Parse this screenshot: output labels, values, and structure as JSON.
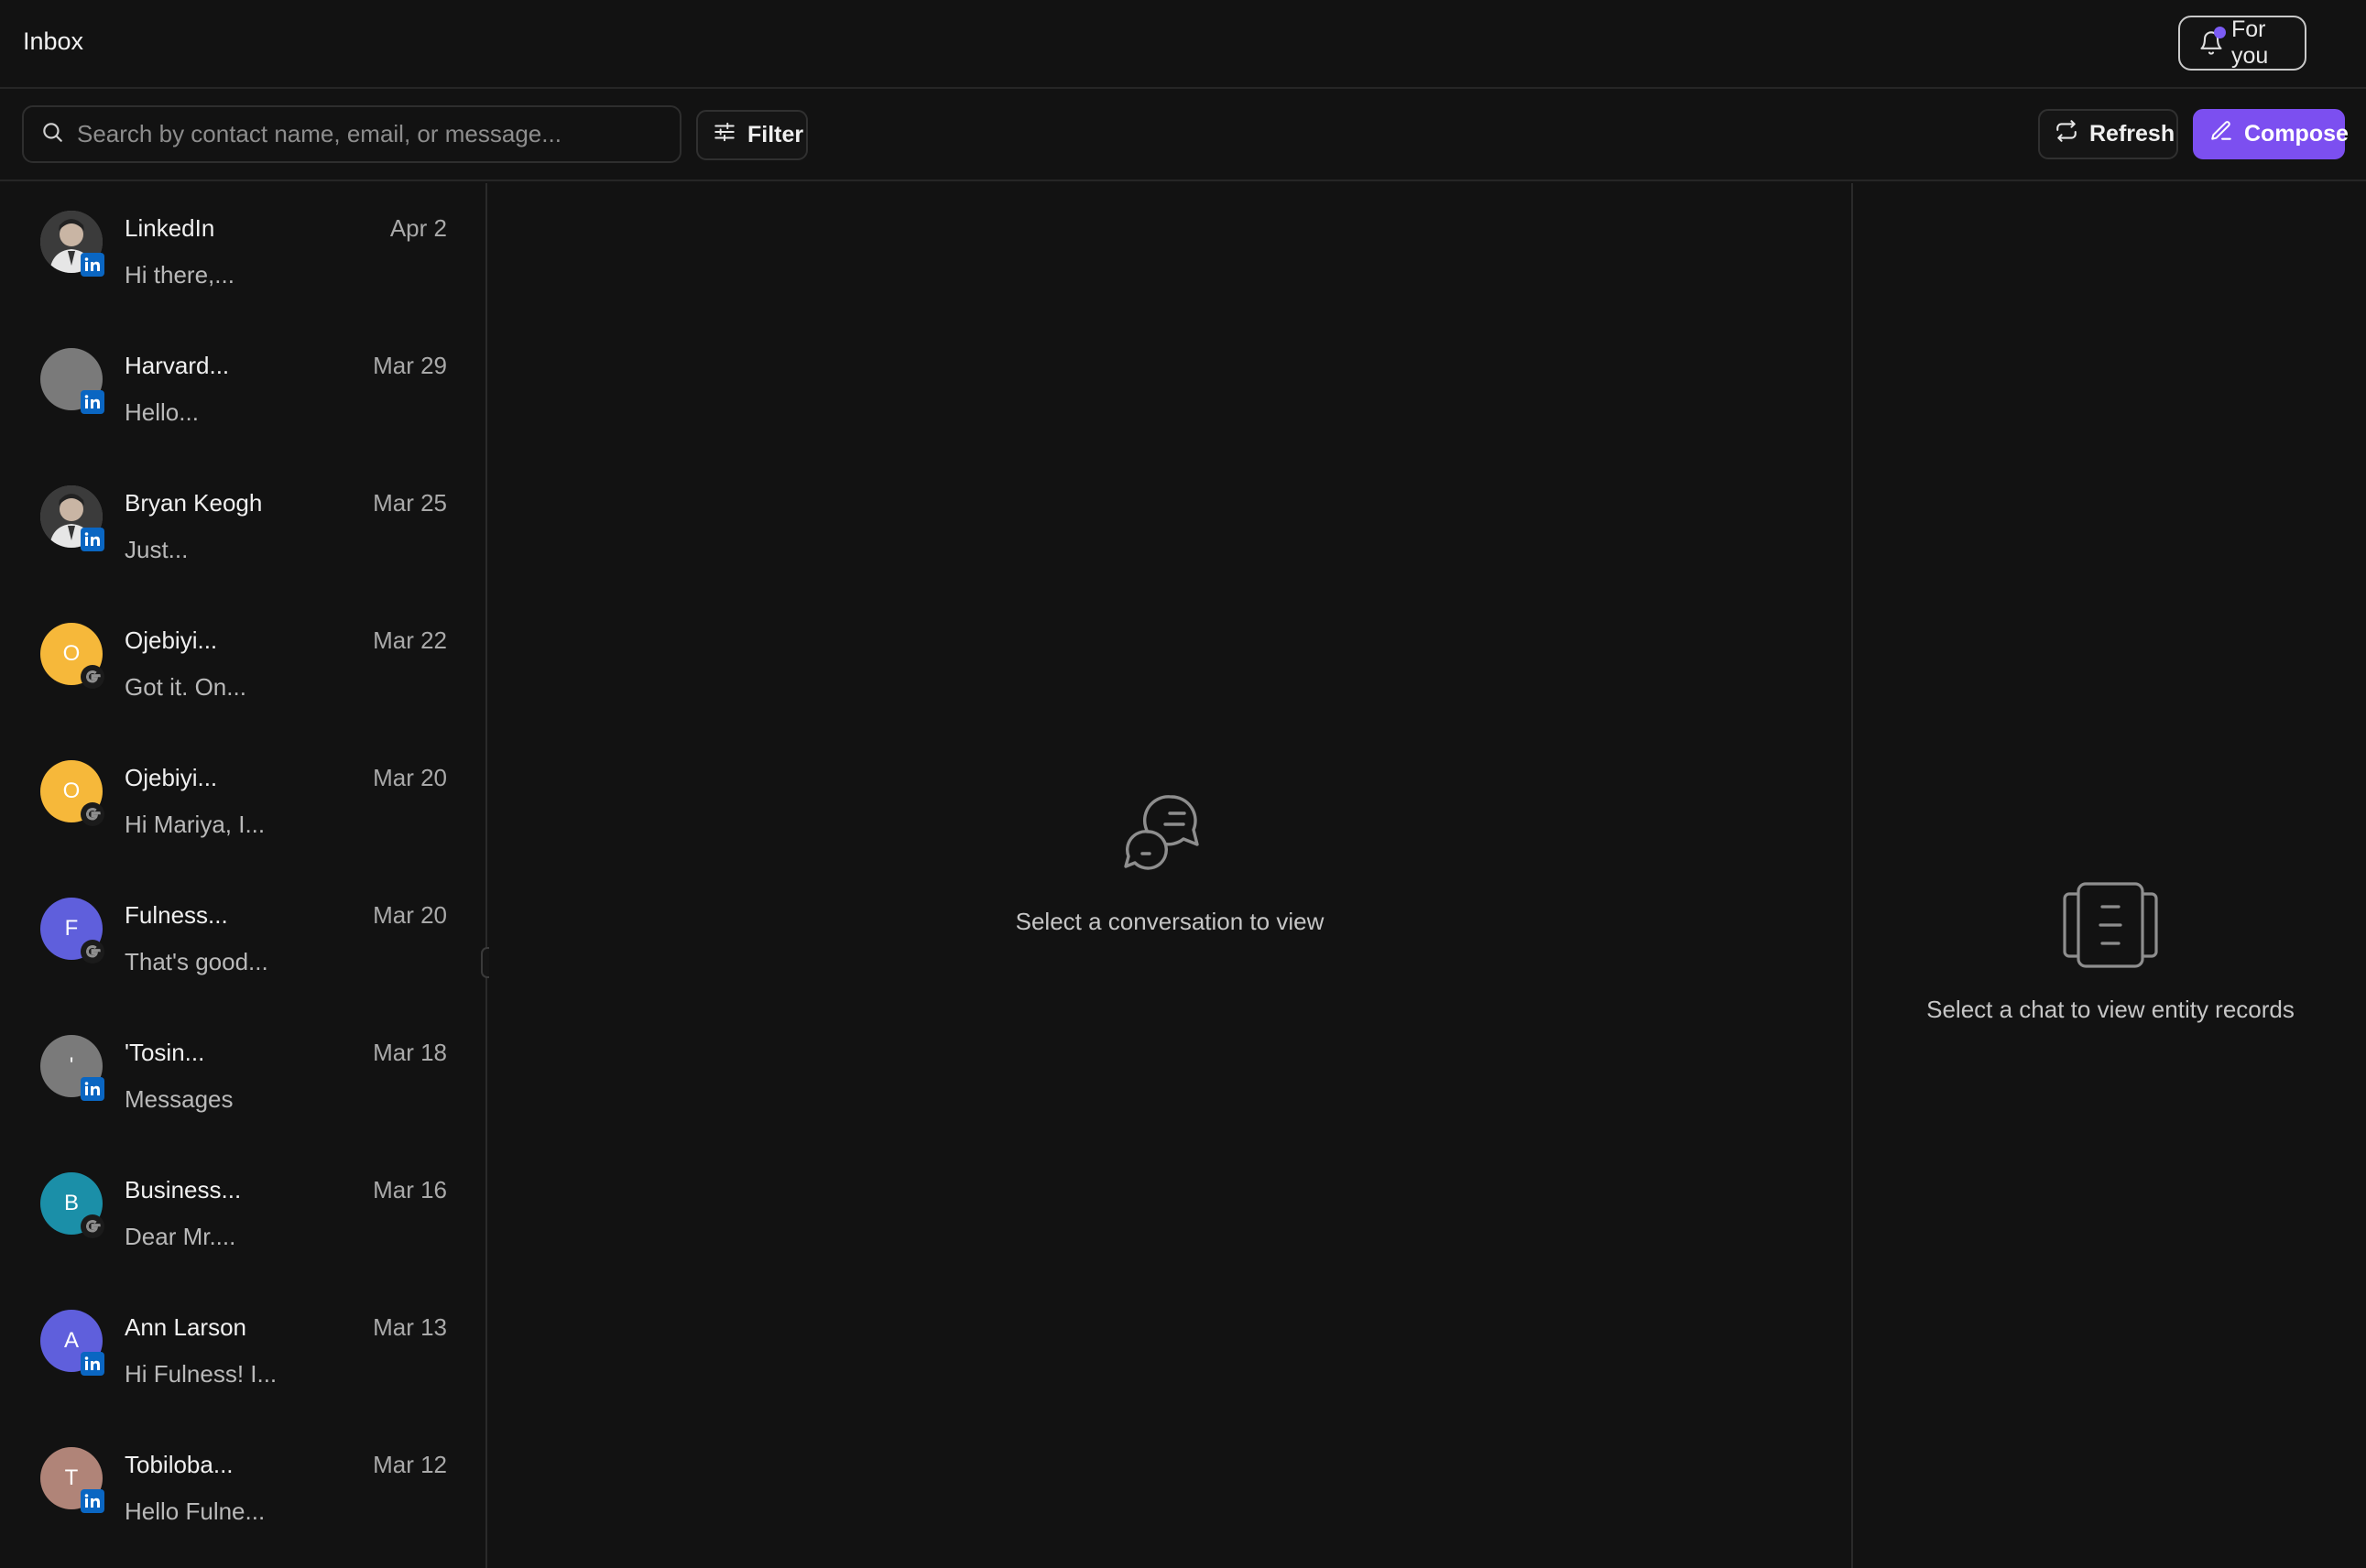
{
  "header": {
    "title": "Inbox",
    "for_you_label": "For you",
    "accent": "#7c5cf5"
  },
  "toolbar": {
    "search_placeholder": "Search by contact name, email, or message...",
    "filter_label": "Filter",
    "refresh_label": "Refresh",
    "compose_label": "Compose",
    "compose_color": "#7c4ff0"
  },
  "conversations": [
    {
      "name": "LinkedIn",
      "date": "Apr 2",
      "preview": "Hi there,...",
      "avatar_initial": "",
      "avatar_color": "#5a5a5a",
      "avatar_type": "photo",
      "source": "linkedin-icon"
    },
    {
      "name": "Harvard...",
      "date": "Mar 29",
      "preview": "Hello...",
      "avatar_initial": "",
      "avatar_color": "#7a7a7a",
      "avatar_type": "blank",
      "source": "linkedin-icon"
    },
    {
      "name": "Bryan Keogh",
      "date": "Mar 25",
      "preview": "Just...",
      "avatar_initial": "",
      "avatar_color": "#606060",
      "avatar_type": "photo",
      "source": "linkedin-icon"
    },
    {
      "name": "Ojebiyi...",
      "date": "Mar 22",
      "preview": "Got it. On...",
      "avatar_initial": "O",
      "avatar_color": "#f6b83a",
      "avatar_type": "initial",
      "source": "google-icon"
    },
    {
      "name": "Ojebiyi...",
      "date": "Mar 20",
      "preview": "Hi Mariya, I...",
      "avatar_initial": "O",
      "avatar_color": "#f6b83a",
      "avatar_type": "initial",
      "source": "google-icon"
    },
    {
      "name": "Fulness...",
      "date": "Mar 20",
      "preview": "That's good...",
      "avatar_initial": "F",
      "avatar_color": "#5f5fdc",
      "avatar_type": "initial",
      "source": "google-icon"
    },
    {
      "name": "'Tosin...",
      "date": "Mar 18",
      "preview": "Messages",
      "avatar_initial": "'",
      "avatar_color": "#7a7a7a",
      "avatar_type": "initial",
      "source": "linkedin-icon"
    },
    {
      "name": "Business...",
      "date": "Mar 16",
      "preview": "Dear Mr....",
      "avatar_initial": "B",
      "avatar_color": "#1b8fa8",
      "avatar_type": "initial",
      "source": "google-icon"
    },
    {
      "name": "Ann Larson",
      "date": "Mar 13",
      "preview": "Hi Fulness! I...",
      "avatar_initial": "A",
      "avatar_color": "#5f5fdc",
      "avatar_type": "initial",
      "source": "linkedin-icon"
    },
    {
      "name": "Tobiloba...",
      "date": "Mar 12",
      "preview": "Hello Fulne...",
      "avatar_initial": "T",
      "avatar_color": "#b08478",
      "avatar_type": "initial",
      "source": "linkedin-icon"
    }
  ],
  "center_pane": {
    "empty_message": "Select a conversation to view",
    "icon": "chat-bubbles-icon"
  },
  "right_pane": {
    "empty_message": "Select a chat to view entity records",
    "icon": "records-icon"
  }
}
